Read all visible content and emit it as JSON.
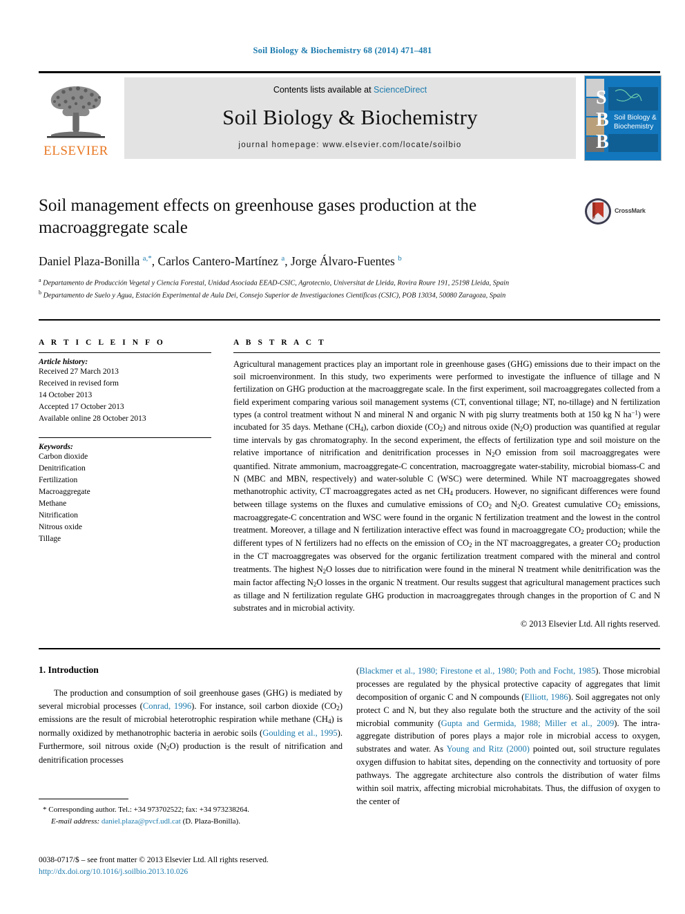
{
  "running_head": "Soil Biology & Biochemistry 68 (2014) 471–481",
  "masthead": {
    "contents_prefix": "Contents lists available at ",
    "contents_link": "ScienceDirect",
    "journal_title": "Soil Biology & Biochemistry",
    "homepage": "journal homepage: www.elsevier.com/locate/soilbio",
    "publisher_logo_text": "ELSEVIER",
    "cover_letters": [
      "S",
      "B",
      "B"
    ],
    "cover_title_line1": "Soil Biology &",
    "cover_title_line2": "Biochemistry"
  },
  "article": {
    "title": "Soil management effects on greenhouse gases production at the macroaggregate scale",
    "crossmark_label": "CrossMark",
    "authors_html": "Daniel Plaza-Bonilla <sup class=\"aff-mark\">a,*</sup>, Carlos Cantero-Martínez <sup class=\"aff-mark\">a</sup>, Jorge Álvaro-Fuentes <sup class=\"aff-mark\">b</sup>",
    "affiliation_a": "Departamento de Producción Vegetal y Ciencia Forestal, Unidad Asociada EEAD-CSIC, Agrotecnio, Universitat de Lleida, Rovira Roure 191, 25198 Lleida, Spain",
    "affiliation_b": "Departamento de Suelo y Agua, Estación Experimental de Aula Dei, Consejo Superior de Investigaciones Científicas (CSIC), POB 13034, 50080 Zaragoza, Spain"
  },
  "article_info": {
    "heading": "A R T I C L E  I N F O",
    "history_label": "Article history:",
    "history": [
      "Received 27 March 2013",
      "Received in revised form",
      "14 October 2013",
      "Accepted 17 October 2013",
      "Available online 28 October 2013"
    ],
    "keywords_label": "Keywords:",
    "keywords": [
      "Carbon dioxide",
      "Denitrification",
      "Fertilization",
      "Macroaggregate",
      "Methane",
      "Nitrification",
      "Nitrous oxide",
      "Tillage"
    ]
  },
  "abstract": {
    "heading": "A B S T R A C T",
    "text_html": "Agricultural management practices play an important role in greenhouse gases (GHG) emissions due to their impact on the soil microenvironment. In this study, two experiments were performed to investigate the influence of tillage and N fertilization on GHG production at the macroaggregate scale. In the first experiment, soil macroaggregates collected from a field experiment comparing various soil management systems (CT, conventional tillage; NT, no-tillage) and N fertilization types (a control treatment without N and mineral N and organic N with pig slurry treatments both at 150 kg N ha<sup>−1</sup>) were incubated for 35 days. Methane (CH<sub>4</sub>), carbon dioxide (CO<sub>2</sub>) and nitrous oxide (N<sub>2</sub>O) production was quantified at regular time intervals by gas chromatography. In the second experiment, the effects of fertilization type and soil moisture on the relative importance of nitrification and denitrification processes in N<sub>2</sub>O emission from soil macroaggregates were quantified. Nitrate ammonium, macroaggregate-C concentration, macroaggregate water-stability, microbial biomass-C and N (MBC and MBN, respectively) and water-soluble C (WSC) were determined. While NT macroaggregates showed methanotrophic activity, CT macroaggregates acted as net CH<sub>4</sub> producers. However, no significant differences were found between tillage systems on the fluxes and cumulative emissions of CO<sub>2</sub> and N<sub>2</sub>O. Greatest cumulative CO<sub>2</sub> emissions, macroaggregate-C concentration and WSC were found in the organic N fertilization treatment and the lowest in the control treatment. Moreover, a tillage and N fertilization interactive effect was found in macroaggregate CO<sub>2</sub> production; while the different types of N fertilizers had no effects on the emission of CO<sub>2</sub> in the NT macroaggregates, a greater CO<sub>2</sub> production in the CT macroaggregates was observed for the organic fertilization treatment compared with the mineral and control treatments. The highest N<sub>2</sub>O losses due to nitrification were found in the mineral N treatment while denitrification was the main factor affecting N<sub>2</sub>O losses in the organic N treatment. Our results suggest that agricultural management practices such as tillage and N fertilization regulate GHG production in macroaggregates through changes in the proportion of C and N substrates and in microbial activity.",
    "copyright": "© 2013 Elsevier Ltd. All rights reserved."
  },
  "introduction": {
    "heading": "1. Introduction",
    "left_html": "The production and consumption of soil greenhouse gases (GHG) is mediated by several microbial processes (<span class=\"ref\">Conrad, 1996</span>). For instance, soil carbon dioxide (CO<sub>2</sub>) emissions are the result of microbial heterotrophic respiration while methane (CH<sub>4</sub>) is normally oxidized by methanotrophic bacteria in aerobic soils (<span class=\"ref\">Goulding et al., 1995</span>). Furthermore, soil nitrous oxide (N<sub>2</sub>O) production is the result of nitrification and denitrification processes",
    "right_html": "(<span class=\"ref\">Blackmer et al., 1980; Firestone et al., 1980; Poth and Focht, 1985</span>). Those microbial processes are regulated by the physical protective capacity of aggregates that limit decomposition of organic C and N compounds (<span class=\"ref\">Elliott, 1986</span>). Soil aggregates not only protect C and N, but they also regulate both the structure and the activity of the soil microbial community (<span class=\"ref\">Gupta and Germida, 1988; Miller et al., 2009</span>). The intra-aggregate distribution of pores plays a major role in microbial access to oxygen, substrates and water. As <span class=\"ref\">Young and Ritz (2000)</span> pointed out, soil structure regulates oxygen diffusion to habitat sites, depending on the connectivity and tortuosity of pore pathways. The aggregate architecture also controls the distribution of water films within soil matrix, affecting microbial microhabitats. Thus, the diffusion of oxygen to the center of"
  },
  "footnote": {
    "corresponding_html": "* Corresponding author. Tel.: +34 973702522; fax: +34 973238264.",
    "email_html": "<i>E-mail address:</i> <span class=\"email-link\">daniel.plaza@pvcf.udl.cat</span> (D. Plaza-Bonilla)."
  },
  "imprint": {
    "line1": "0038-0717/$ – see front matter © 2013 Elsevier Ltd. All rights reserved.",
    "doi": "http://dx.doi.org/10.1016/j.soilbio.2013.10.026"
  },
  "colors": {
    "link_blue": "#1b7aad",
    "elsevier_orange": "#e87722",
    "cover_blue": "#1277bd",
    "masthead_grey": "#e3e3e3"
  }
}
